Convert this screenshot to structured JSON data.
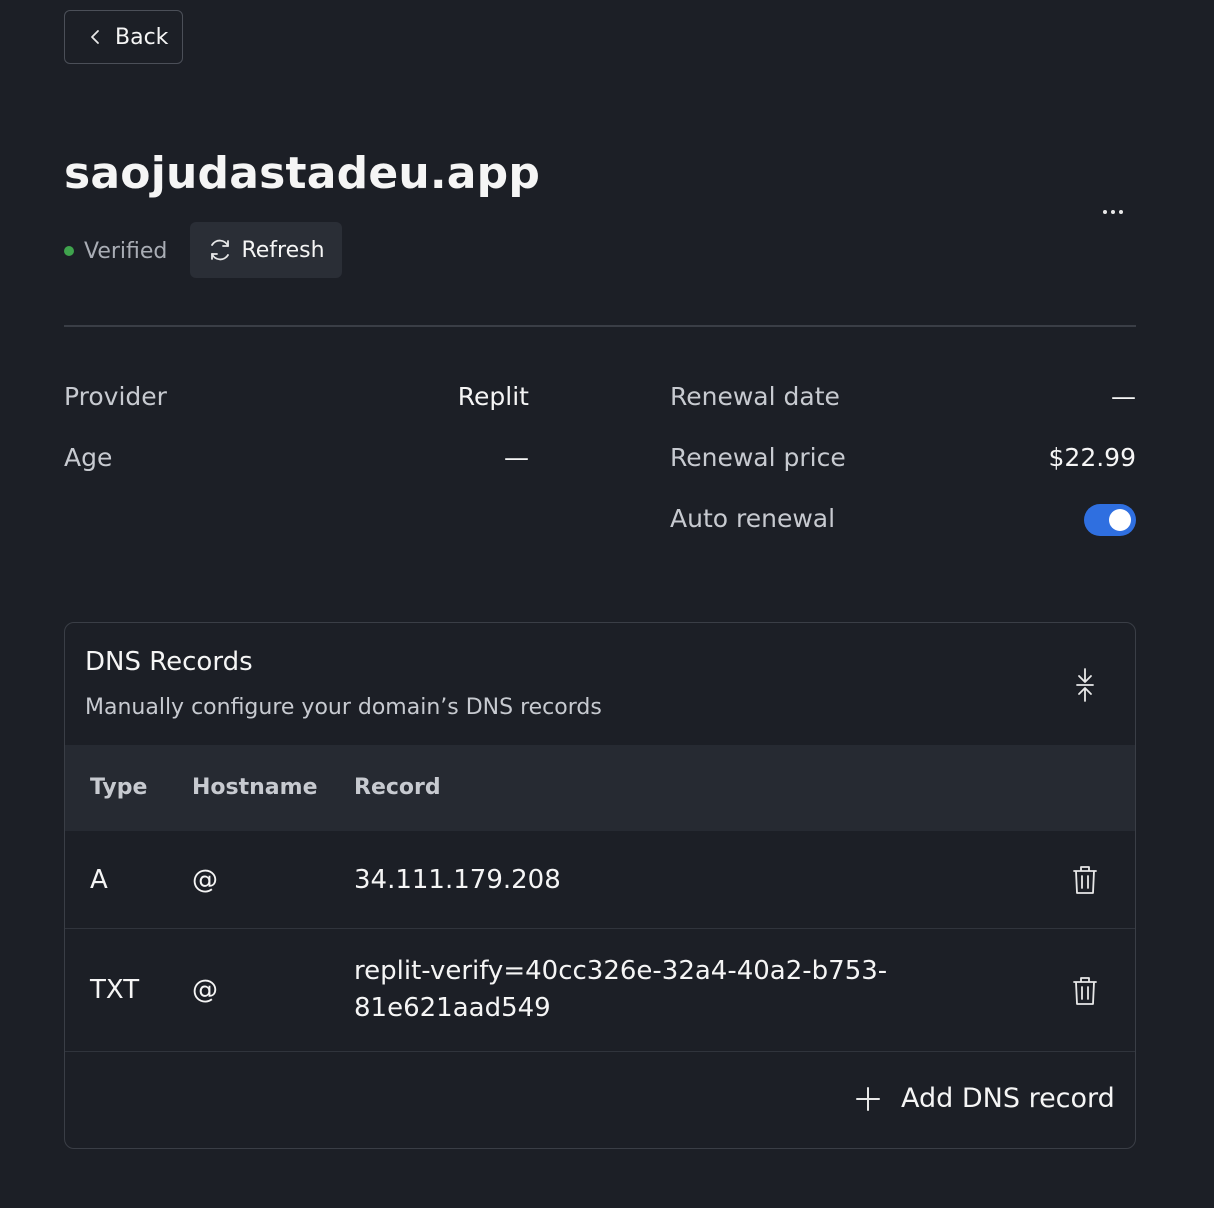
{
  "back_label": "Back",
  "domain": {
    "name": "saojudastadeu.app",
    "status": "Verified",
    "status_color": "#3fa34d",
    "refresh_label": "Refresh"
  },
  "details": {
    "provider_label": "Provider",
    "provider_value": "Replit",
    "age_label": "Age",
    "age_value": "—",
    "renewal_date_label": "Renewal date",
    "renewal_date_value": "—",
    "renewal_price_label": "Renewal price",
    "renewal_price_value": "$22.99",
    "auto_renewal_label": "Auto renewal",
    "auto_renewal_on": true,
    "toggle_color": "#2f6fe0"
  },
  "dns": {
    "title": "DNS Records",
    "subtitle": "Manually configure your domain’s DNS records",
    "columns": [
      "Type",
      "Hostname",
      "Record"
    ],
    "records": [
      {
        "type": "A",
        "hostname": "@",
        "record": "34.111.179.208"
      },
      {
        "type": "TXT",
        "hostname": "@",
        "record_line1": "replit-verify=40cc326e-32a4-40a2-b753-",
        "record_line2": "81e621aad549"
      }
    ],
    "add_label": "Add DNS record"
  }
}
